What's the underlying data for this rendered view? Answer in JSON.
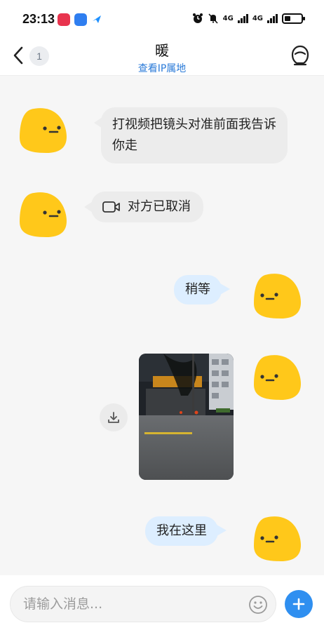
{
  "status_bar": {
    "time": "23:13",
    "network_label_1": "4G",
    "network_label_2": "4G"
  },
  "header": {
    "contact_name": "暖",
    "ip_link": "查看IP属地",
    "unread_count": "1"
  },
  "messages": {
    "m1_text": "打视频把镜头对准前面我告诉你走",
    "m2_call_status": "对方已取消",
    "m3_text": "稍等",
    "m5_text": "我在这里"
  },
  "input": {
    "placeholder": "请输入消息..."
  },
  "colors": {
    "accent": "#2f8ff0",
    "link": "#2b7bd8",
    "outgoing_bubble": "#ddeeff",
    "incoming_bubble": "#ececec",
    "avatar_yellow": "#ffc81a"
  },
  "icons": [
    "back-chevron-icon",
    "profile-icon",
    "video-camera-icon",
    "download-icon",
    "emoji-icon",
    "plus-icon",
    "alarm-icon",
    "mute-bell-icon",
    "battery-icon"
  ]
}
